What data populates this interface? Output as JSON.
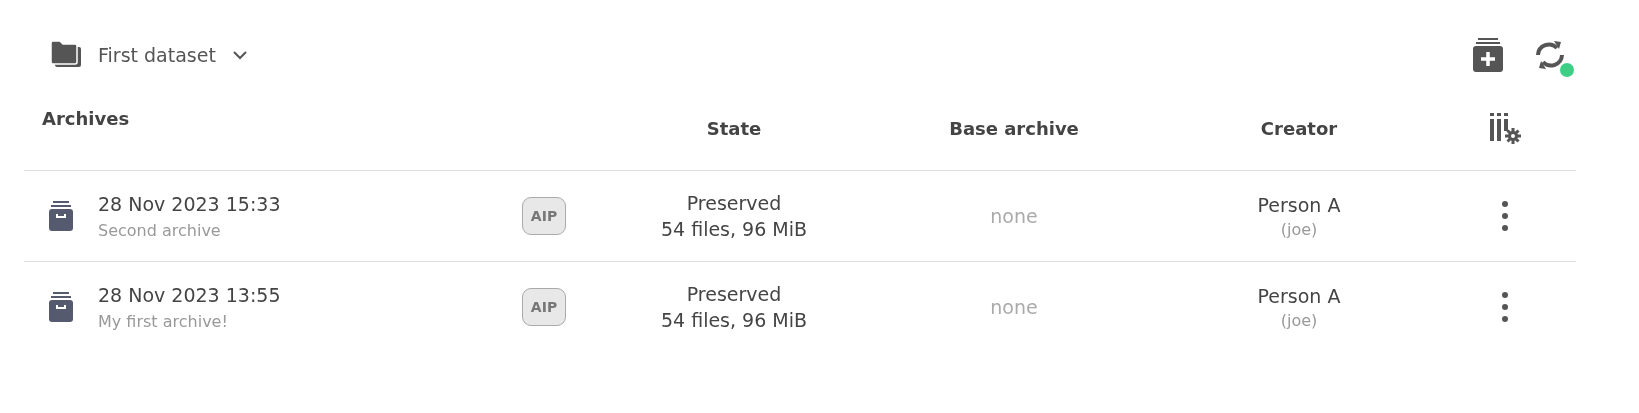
{
  "dataset": {
    "name": "First dataset"
  },
  "sync": {
    "connected": true
  },
  "table": {
    "columns": [
      "Archives",
      "State",
      "Base archive",
      "Creator"
    ],
    "rows": [
      {
        "date": "28 Nov 2023 15:33",
        "description": "Second archive",
        "badge": "AIP",
        "state": "Preserved",
        "details": "54 files, 96 MiB",
        "base": "none",
        "creator": "Person A",
        "username": "(joe)"
      },
      {
        "date": "28 Nov 2023 13:55",
        "description": "My first archive!",
        "badge": "AIP",
        "state": "Preserved",
        "details": "54 files, 96 MiB",
        "base": "none",
        "creator": "Person A",
        "username": "(joe)"
      }
    ]
  }
}
